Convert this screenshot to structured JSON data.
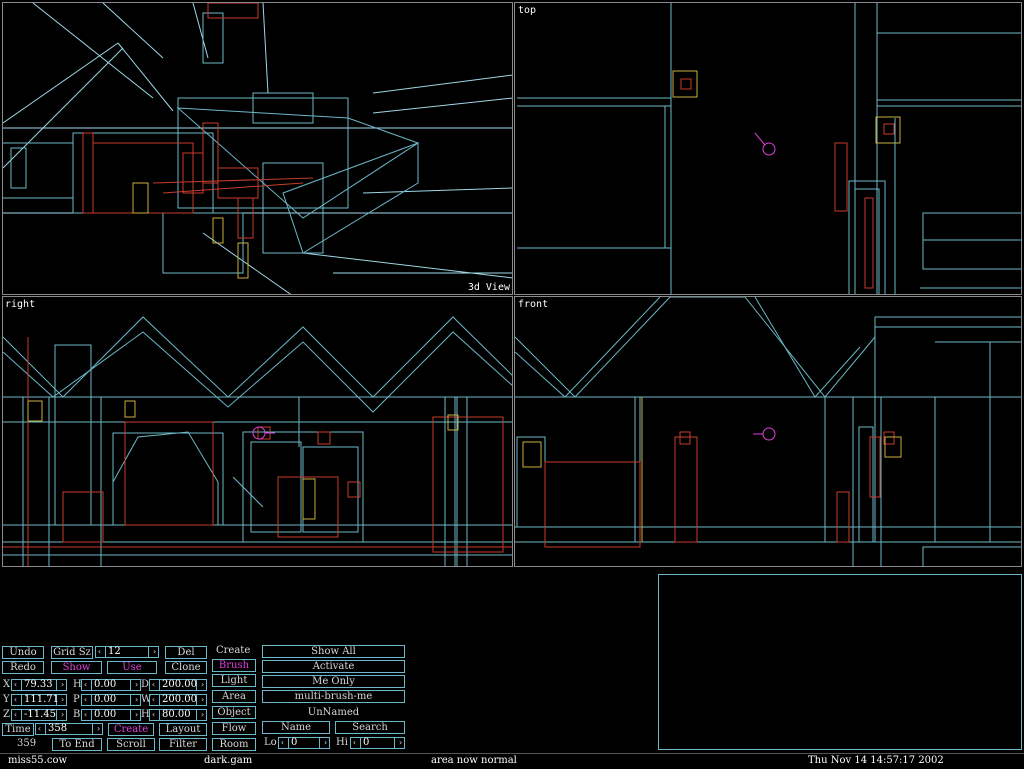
{
  "viewports": {
    "view3d": "3d View",
    "top": "top",
    "right": "right",
    "front": "front"
  },
  "toolbar": {
    "undo": "Undo",
    "redo": "Redo",
    "grid_sz": "Grid Sz",
    "grid_value": "12",
    "show": "Show",
    "use": "Use",
    "del": "Del",
    "clone": "Clone",
    "create_label": "Create",
    "brush": "Brush",
    "light": "Light",
    "area": "Area",
    "object": "Object",
    "flow": "Flow",
    "room": "Room",
    "show_all": "Show All",
    "activate": "Activate",
    "me_only": "Me Only",
    "multi_brush": "multi-brush-me",
    "unnamed": "UnNamed",
    "name": "Name",
    "search": "Search",
    "lo": "Lo",
    "lo_value": "0",
    "hi": "Hi",
    "hi_value": "0",
    "x_label": "X",
    "x_value": "79.33",
    "y_label": "Y",
    "y_value": "111.71",
    "z_label": "Z",
    "z_value": "-11.45",
    "h_label": "H",
    "h_value": "0.00",
    "p_label": "P",
    "p_value": "0.00",
    "b_label": "B",
    "b_value": "0.00",
    "d_label": "D",
    "d_value": "200.00",
    "w_label": "W",
    "w_value": "200.00",
    "hh_label": "H",
    "hh_value": "80.00",
    "time": "Time",
    "time_value": "358",
    "time_count": "359",
    "create": "Create",
    "layout": "Layout",
    "to_end": "To End",
    "scroll": "Scroll",
    "filter": "Filter"
  },
  "status_bar": {
    "file": "miss55.cow",
    "gamefile": "dark.gam",
    "message": "area now normal",
    "timestamp": "Thu Nov 14 14:57:17 2002"
  },
  "colors": {
    "cyan": "#6bb8c8",
    "red": "#c83c2c",
    "magenta": "#e040e0",
    "yellow": "#c8b040"
  }
}
